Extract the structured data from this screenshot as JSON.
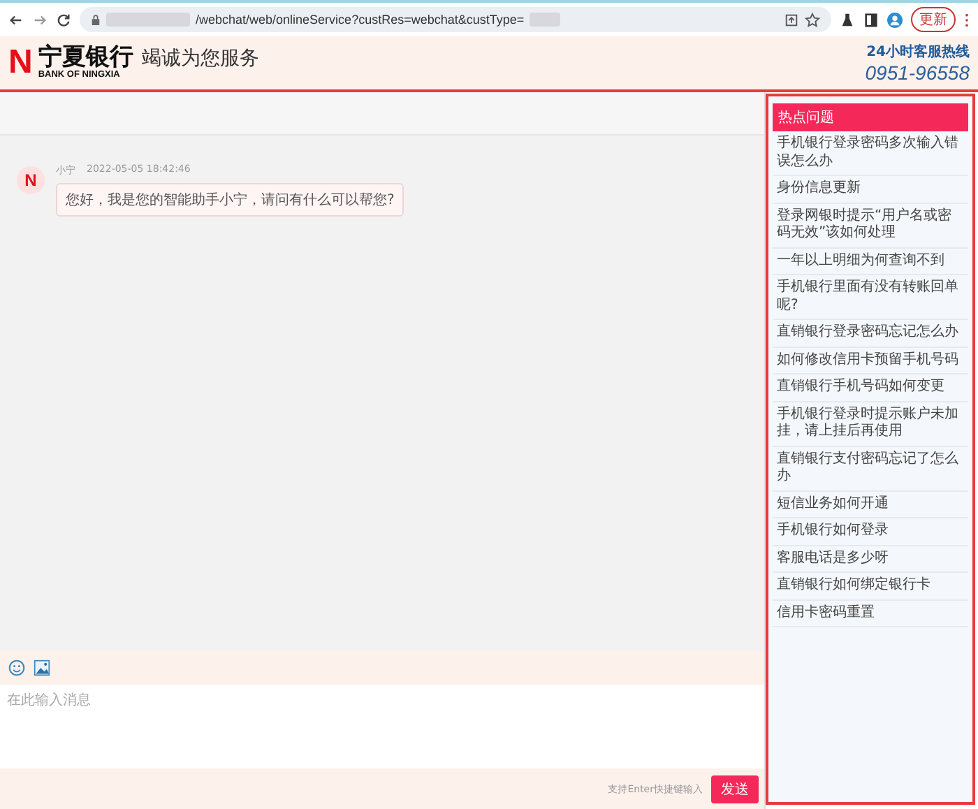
{
  "browser": {
    "url": "/webchat/web/onlineService?custRes=webchat&custType=",
    "update_button": "更新"
  },
  "header": {
    "logo_mark": "N",
    "bank_name": "宁夏银行",
    "bank_name_en": "BANK OF NINGXIA",
    "slogan": "竭诚为您服务",
    "hotline_label": "24小时客服热线",
    "hotline_number": "0951-96558"
  },
  "chat": {
    "messages": [
      {
        "avatar": "N",
        "sender": "小宁",
        "time": "2022-05-05 18:42:46",
        "text": "您好，我是您的智能助手小宁，请问有什么可以帮您?"
      }
    ],
    "input": {
      "placeholder": "在此输入消息"
    },
    "hint": "支持Enter快捷键输入",
    "send_button": "发送"
  },
  "hot_questions": {
    "title": "热点问题",
    "items": [
      "手机银行登录密码多次输入错误怎么办",
      "身份信息更新",
      "登录网银时提示“用户名或密码无效”该如何处理",
      "一年以上明细为何查询不到",
      "手机银行里面有没有转账回单呢?",
      "直销银行登录密码忘记怎么办",
      "如何修改信用卡预留手机号码",
      "直销银行手机号码如何变更",
      "手机银行登录时提示账户未加挂，请上挂后再使用",
      "直销银行支付密码忘记了怎么办",
      "短信业务如何开通",
      "手机银行如何登录",
      "客服电话是多少呀",
      "直销银行如何绑定银行卡",
      "信用卡密码重置"
    ]
  }
}
